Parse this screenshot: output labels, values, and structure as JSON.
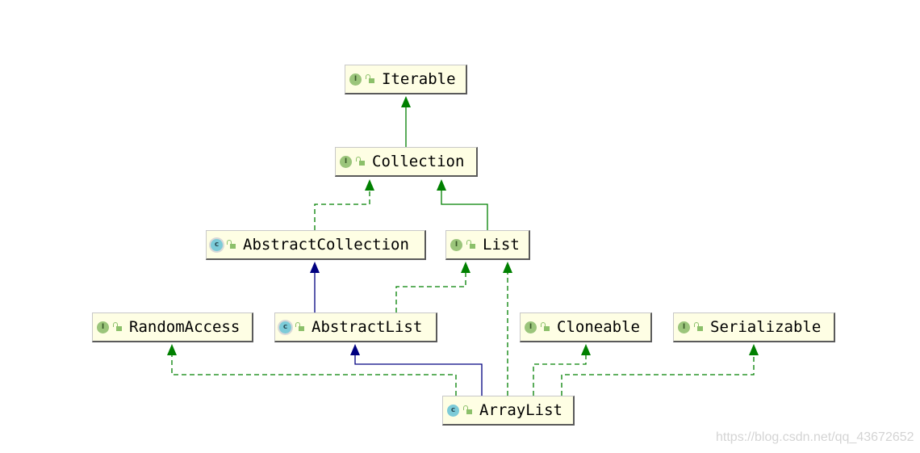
{
  "nodes": {
    "iterable": {
      "name": "Iterable",
      "kind": "I"
    },
    "collection": {
      "name": "Collection",
      "kind": "I"
    },
    "abstract_collection": {
      "name": "AbstractCollection",
      "kind": "c"
    },
    "list": {
      "name": "List",
      "kind": "I"
    },
    "random_access": {
      "name": "RandomAccess",
      "kind": "I"
    },
    "abstract_list": {
      "name": "AbstractList",
      "kind": "c"
    },
    "cloneable": {
      "name": "Cloneable",
      "kind": "I"
    },
    "serializable": {
      "name": "Serializable",
      "kind": "I"
    },
    "array_list": {
      "name": "ArrayList",
      "kind": "c"
    }
  },
  "edges": [
    {
      "from": "Collection",
      "to": "Iterable",
      "type": "extends"
    },
    {
      "from": "AbstractCollection",
      "to": "Collection",
      "type": "implements"
    },
    {
      "from": "List",
      "to": "Collection",
      "type": "extends"
    },
    {
      "from": "AbstractList",
      "to": "AbstractCollection",
      "type": "extends-class"
    },
    {
      "from": "AbstractList",
      "to": "List",
      "type": "implements"
    },
    {
      "from": "ArrayList",
      "to": "RandomAccess",
      "type": "implements"
    },
    {
      "from": "ArrayList",
      "to": "AbstractList",
      "type": "extends-class"
    },
    {
      "from": "ArrayList",
      "to": "List",
      "type": "implements"
    },
    {
      "from": "ArrayList",
      "to": "Cloneable",
      "type": "implements"
    },
    {
      "from": "ArrayList",
      "to": "Serializable",
      "type": "implements"
    }
  ],
  "colors": {
    "interface_edge": "#008000",
    "class_edge": "#000080",
    "node_fill": "#fefee4"
  },
  "watermark": "https://blog.csdn.net/qq_43672652"
}
